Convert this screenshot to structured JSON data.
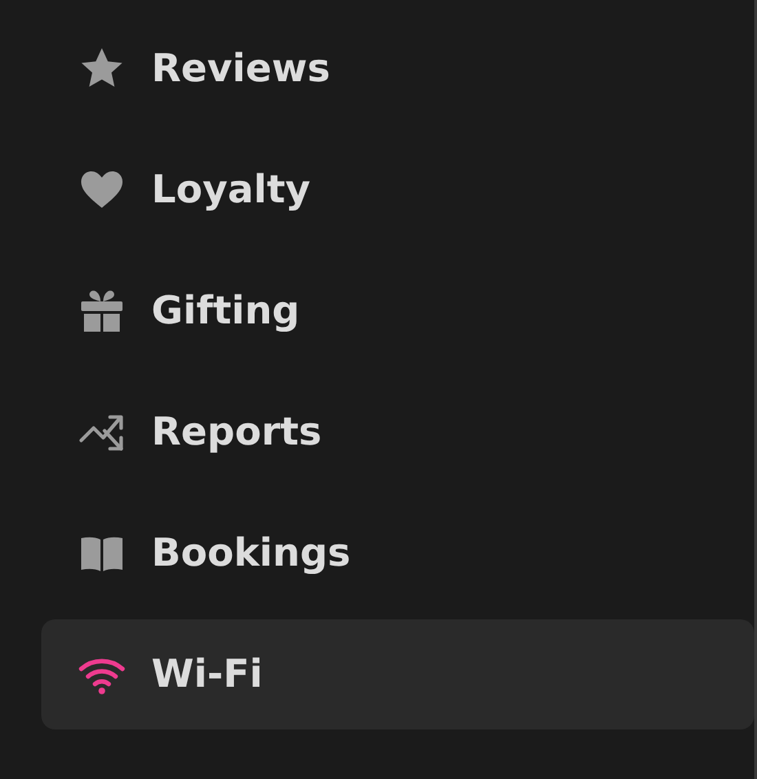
{
  "sidebar": {
    "items": [
      {
        "label": "Reviews",
        "kind": "star",
        "selected": false
      },
      {
        "label": "Loyalty",
        "kind": "heart",
        "selected": false
      },
      {
        "label": "Gifting",
        "kind": "gift",
        "selected": false
      },
      {
        "label": "Reports",
        "kind": "trend",
        "selected": false
      },
      {
        "label": "Bookings",
        "kind": "book",
        "selected": false
      },
      {
        "label": "Wi-Fi",
        "kind": "wifi",
        "selected": true
      }
    ]
  }
}
